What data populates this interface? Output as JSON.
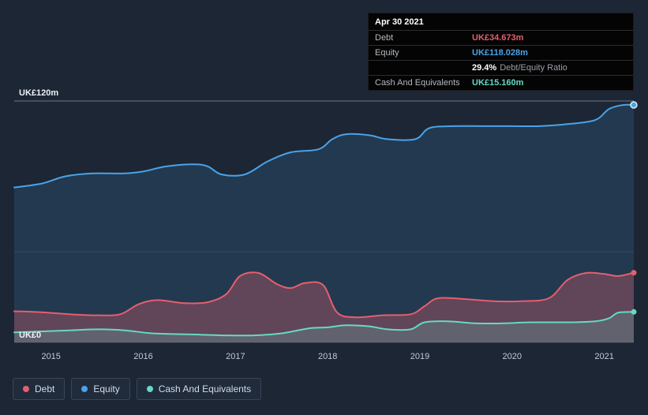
{
  "tooltip": {
    "date": "Apr 30 2021",
    "debt_label": "Debt",
    "debt_value": "UK£34.673m",
    "equity_label": "Equity",
    "equity_value": "UK£118.028m",
    "ratio_value": "29.4%",
    "ratio_label": "Debt/Equity Ratio",
    "cash_label": "Cash And Equivalents",
    "cash_value": "UK£15.160m"
  },
  "axis": {
    "y_top_label": "UK£120m",
    "y_bottom_label": "UK£0"
  },
  "legend": {
    "items": [
      {
        "label": "Debt",
        "color": "#e55f6d"
      },
      {
        "label": "Equity",
        "color": "#4aa3e8"
      },
      {
        "label": "Cash And Equivalents",
        "color": "#66d9c3"
      }
    ]
  },
  "chart_data": {
    "type": "area",
    "unit": "UK£m",
    "ylim": [
      0,
      120
    ],
    "x_range": [
      2014.6,
      2021.32
    ],
    "x_ticks": [
      2015,
      2016,
      2017,
      2018,
      2019,
      2020,
      2021
    ],
    "gridline_values": [
      120,
      45
    ],
    "legend_position": "bottom-left",
    "latest_point": {
      "date": "Apr 30 2021",
      "debt": 34.673,
      "equity": 118.028,
      "cash_and_equivalents": 15.16,
      "debt_equity_ratio_pct": 29.4
    },
    "series": [
      {
        "name": "Equity",
        "color": "#4aa3e8",
        "fill": "rgba(74,163,232,0.16)",
        "ring": true,
        "points": [
          [
            2014.6,
            77
          ],
          [
            2014.9,
            79
          ],
          [
            2015.15,
            82.5
          ],
          [
            2015.45,
            84
          ],
          [
            2015.8,
            84
          ],
          [
            2016.0,
            85
          ],
          [
            2016.25,
            87.5
          ],
          [
            2016.55,
            88.5
          ],
          [
            2016.7,
            87.5
          ],
          [
            2016.85,
            83.5
          ],
          [
            2017.1,
            83.5
          ],
          [
            2017.35,
            90
          ],
          [
            2017.6,
            94.5
          ],
          [
            2017.9,
            96
          ],
          [
            2018.05,
            101
          ],
          [
            2018.2,
            103.5
          ],
          [
            2018.45,
            103
          ],
          [
            2018.65,
            101
          ],
          [
            2018.95,
            101
          ],
          [
            2019.1,
            106.5
          ],
          [
            2019.35,
            107.5
          ],
          [
            2019.7,
            107.5
          ],
          [
            2020.0,
            107.5
          ],
          [
            2020.3,
            107.5
          ],
          [
            2020.6,
            108.5
          ],
          [
            2020.9,
            110.5
          ],
          [
            2021.05,
            116
          ],
          [
            2021.2,
            118
          ],
          [
            2021.32,
            118.028
          ]
        ]
      },
      {
        "name": "Debt",
        "color": "#e55f6d",
        "fill": "rgba(229,95,109,0.32)",
        "ring": false,
        "points": [
          [
            2014.6,
            15.5
          ],
          [
            2014.9,
            15
          ],
          [
            2015.2,
            14
          ],
          [
            2015.5,
            13.5
          ],
          [
            2015.75,
            14
          ],
          [
            2015.95,
            19
          ],
          [
            2016.15,
            21
          ],
          [
            2016.45,
            19.5
          ],
          [
            2016.7,
            20
          ],
          [
            2016.9,
            24
          ],
          [
            2017.05,
            33
          ],
          [
            2017.25,
            34.5
          ],
          [
            2017.45,
            29
          ],
          [
            2017.6,
            27
          ],
          [
            2017.75,
            29.5
          ],
          [
            2017.95,
            28.5
          ],
          [
            2018.1,
            15
          ],
          [
            2018.3,
            12.5
          ],
          [
            2018.6,
            13.5
          ],
          [
            2018.9,
            14
          ],
          [
            2019.05,
            18
          ],
          [
            2019.2,
            22
          ],
          [
            2019.5,
            21.5
          ],
          [
            2019.8,
            20.5
          ],
          [
            2020.1,
            20.5
          ],
          [
            2020.4,
            22
          ],
          [
            2020.6,
            31
          ],
          [
            2020.8,
            34.5
          ],
          [
            2021.0,
            34
          ],
          [
            2021.15,
            33
          ],
          [
            2021.32,
            34.673
          ]
        ]
      },
      {
        "name": "Cash And Equivalents",
        "color": "#66d9c3",
        "fill": "rgba(102,217,195,0.20)",
        "ring": false,
        "points": [
          [
            2014.6,
            5
          ],
          [
            2014.9,
            5.5
          ],
          [
            2015.2,
            6
          ],
          [
            2015.5,
            6.5
          ],
          [
            2015.8,
            6
          ],
          [
            2016.1,
            4.5
          ],
          [
            2016.5,
            4
          ],
          [
            2016.9,
            3.5
          ],
          [
            2017.2,
            3.5
          ],
          [
            2017.5,
            4.5
          ],
          [
            2017.8,
            7
          ],
          [
            2018.0,
            7.5
          ],
          [
            2018.2,
            8.5
          ],
          [
            2018.45,
            8
          ],
          [
            2018.65,
            6.5
          ],
          [
            2018.9,
            6.5
          ],
          [
            2019.05,
            10
          ],
          [
            2019.3,
            10.5
          ],
          [
            2019.6,
            9.5
          ],
          [
            2019.9,
            9.5
          ],
          [
            2020.2,
            10
          ],
          [
            2020.6,
            10
          ],
          [
            2020.9,
            10.5
          ],
          [
            2021.05,
            12
          ],
          [
            2021.15,
            14.8
          ],
          [
            2021.32,
            15.16
          ]
        ]
      }
    ]
  }
}
